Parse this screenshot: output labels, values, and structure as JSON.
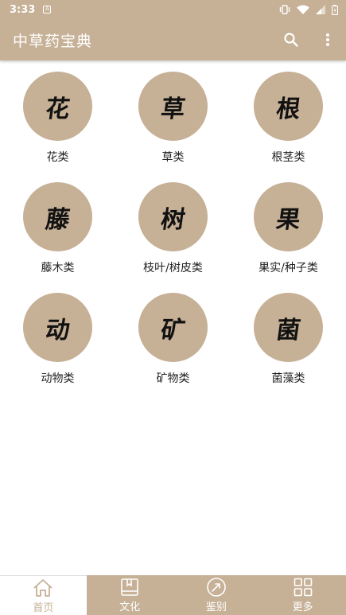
{
  "status_bar": {
    "time": "3:33",
    "notification_glyph": "A"
  },
  "app_bar": {
    "title": "中草药宝典",
    "search_icon": "search-icon",
    "more_icon": "more-vert-icon"
  },
  "categories": [
    {
      "glyph": "花",
      "label": "花类"
    },
    {
      "glyph": "草",
      "label": "草类"
    },
    {
      "glyph": "根",
      "label": "根茎类"
    },
    {
      "glyph": "藤",
      "label": "藤木类"
    },
    {
      "glyph": "树",
      "label": "枝叶/树皮类"
    },
    {
      "glyph": "果",
      "label": "果实/种子类"
    },
    {
      "glyph": "动",
      "label": "动物类"
    },
    {
      "glyph": "矿",
      "label": "矿物类"
    },
    {
      "glyph": "菌",
      "label": "菌藻类"
    }
  ],
  "bottom_nav": [
    {
      "label": "首页",
      "icon": "home-icon",
      "active": true
    },
    {
      "label": "文化",
      "icon": "book-icon",
      "active": false
    },
    {
      "label": "鉴别",
      "icon": "compass-icon",
      "active": false
    },
    {
      "label": "更多",
      "icon": "grid-icon",
      "active": false
    }
  ],
  "colors": {
    "accent": "#c6b096",
    "background": "#ffffff",
    "text": "#222222"
  }
}
